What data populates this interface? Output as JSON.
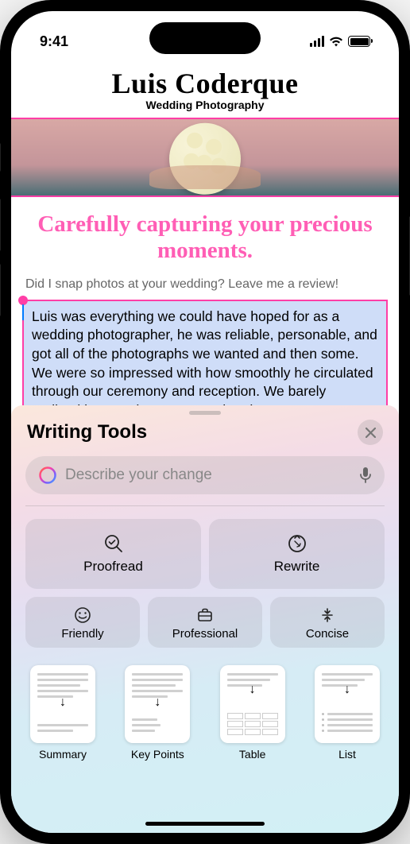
{
  "status": {
    "time": "9:41"
  },
  "page": {
    "name": "Luis Coderque",
    "subtitle": "Wedding Photography",
    "tagline": "Carefully capturing your precious moments.",
    "reviewPrompt": "Did I snap photos at your wedding? Leave me a review!",
    "selectedText": "Luis was everything we could have hoped for as a wedding photographer, he was reliable, personable, and got all of the photographs we wanted and then some. We were so impressed with how smoothly he circulated through our ceremony and reception. We barely realized he was there except when he was very"
  },
  "sheet": {
    "title": "Writing Tools",
    "placeholder": "Describe your change",
    "actions": {
      "proofread": "Proofread",
      "rewrite": "Rewrite",
      "friendly": "Friendly",
      "professional": "Professional",
      "concise": "Concise"
    },
    "formats": {
      "summary": "Summary",
      "keypoints": "Key Points",
      "table": "Table",
      "list": "List"
    }
  }
}
